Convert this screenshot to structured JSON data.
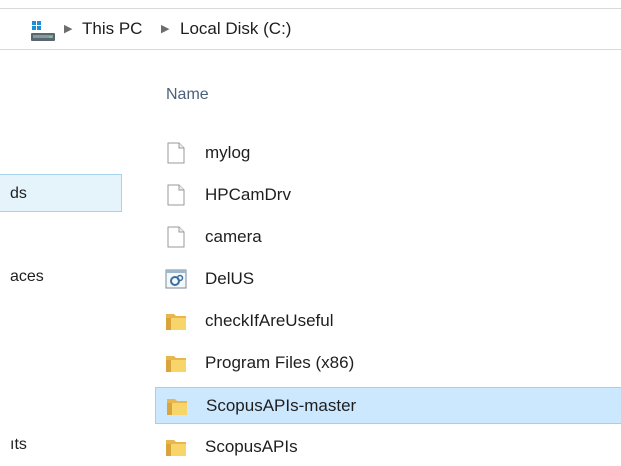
{
  "address_bar": {
    "icon": "computer-drive-icon",
    "breadcrumbs": [
      "This PC",
      "Local Disk (C:)"
    ]
  },
  "nav_pane": {
    "items": [
      {
        "label": "ds",
        "selected": true
      },
      {
        "label": "aces",
        "selected": false
      },
      {
        "label": "ıts",
        "selected": false
      }
    ]
  },
  "file_list": {
    "column_header": "Name",
    "items": [
      {
        "name": "mylog",
        "icon": "text-file-icon",
        "selected": false
      },
      {
        "name": "HPCamDrv",
        "icon": "text-file-icon",
        "selected": false
      },
      {
        "name": "camera",
        "icon": "text-file-icon",
        "selected": false
      },
      {
        "name": "DelUS",
        "icon": "config-file-icon",
        "selected": false
      },
      {
        "name": "checkIfAreUseful",
        "icon": "folder-icon",
        "selected": false
      },
      {
        "name": "Program Files (x86)",
        "icon": "folder-icon",
        "selected": false
      },
      {
        "name": "ScopusAPIs-master",
        "icon": "folder-icon",
        "selected": true
      },
      {
        "name": "ScopusAPIs",
        "icon": "folder-icon",
        "selected": false
      }
    ]
  },
  "colors": {
    "selection_bg": "#cce8ff",
    "selection_border": "#99d1ff",
    "nav_selection_bg": "#e5f3fb",
    "header_text": "#4c607a"
  }
}
